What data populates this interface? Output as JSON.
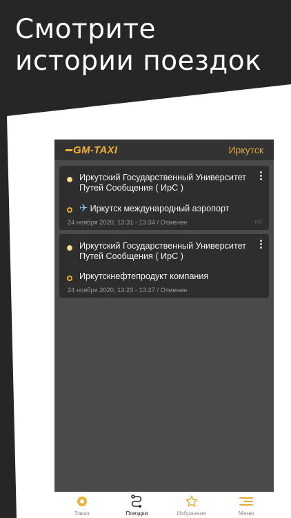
{
  "promo": {
    "line1": "Смотрите",
    "line2": "истории поездок"
  },
  "app": {
    "logo": "GM-TAXI",
    "city": "Иркутск"
  },
  "trips": [
    {
      "from": "Иркутский Государственный Университет Путей Сообщения ( ИрС )",
      "to": "Иркутск международный аэропорт",
      "meta": "24 ноября 2020, 13:31 - 13:34 / Отменен"
    },
    {
      "from": "Иркутский Государственный Университет Путей Сообщения ( ИрС )",
      "to": "Иркутскнефтепродукт компания",
      "meta": "24 ноября 2020, 13:23 - 13:27 / Отменен"
    }
  ],
  "tabs": {
    "order": "Заказ",
    "trips": "Поездки",
    "favorites": "Избранное",
    "menu": "Меню",
    "active": "trips"
  },
  "colors": {
    "accent": "#e5ab32",
    "card": "#2e2e2e",
    "list_bg": "#4a4a4a",
    "promo_bg": "#262626"
  }
}
